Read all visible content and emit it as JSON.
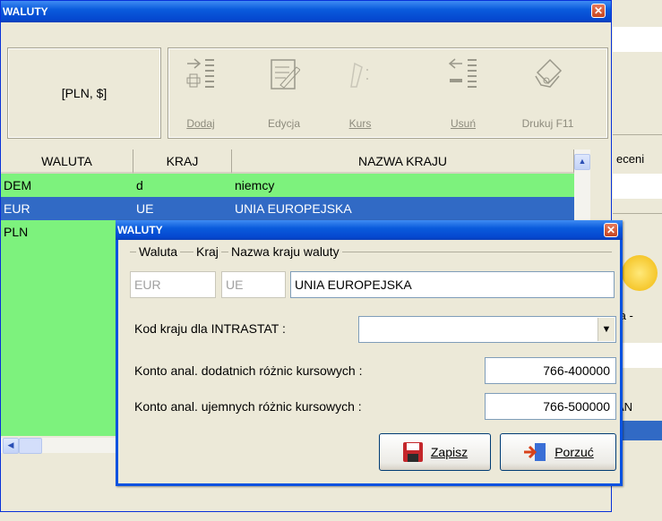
{
  "main_window": {
    "title": "WALUTY",
    "close_glyph": "✕",
    "current_selection": "[PLN, $]",
    "toolbar": [
      {
        "label": "Dodaj",
        "icon": "add-icon"
      },
      {
        "label": "Edycja",
        "icon": "edit-icon"
      },
      {
        "label": "Kurs",
        "icon": "rate-icon"
      },
      {
        "label": "Usuń",
        "icon": "delete-icon"
      },
      {
        "label": "Drukuj F11",
        "icon": "print-icon"
      }
    ],
    "table": {
      "columns": [
        "WALUTA",
        "KRAJ",
        "NAZWA KRAJU"
      ],
      "rows": [
        {
          "waluta": "DEM",
          "kraj": "d",
          "nazwa": "niemcy"
        },
        {
          "waluta": "EUR",
          "kraj": "UE",
          "nazwa": "UNIA EUROPEJSKA"
        },
        {
          "waluta": "PLN",
          "kraj": "",
          "nazwa": ""
        }
      ]
    }
  },
  "background_app": {
    "fragments": [
      "eceni",
      "ta -",
      "AN"
    ]
  },
  "dialog": {
    "title": "WALUTY",
    "close_glyph": "✕",
    "legend": {
      "waluta": "Waluta",
      "kraj": "Kraj",
      "nazwa": "Nazwa kraju waluty"
    },
    "fields": {
      "waluta": "EUR",
      "kraj": "UE",
      "nazwa": "UNIA EUROPEJSKA"
    },
    "intrastat_label": "Kod kraju dla INTRASTAT :",
    "intrastat_value": "",
    "konto_dodatnich_label": "Konto anal. dodatnich różnic kursowych  :",
    "konto_dodatnich_value": "766-400000",
    "konto_ujemnych_label": "Konto anal. ujemnych różnic kursowych  :",
    "konto_ujemnych_value": "766-500000",
    "save_label": "Zapisz",
    "cancel_label": "Porzuć"
  },
  "colors": {
    "titlebar": "#0a5bdc",
    "row_green": "#7df27d",
    "row_selected": "#316ac5"
  }
}
